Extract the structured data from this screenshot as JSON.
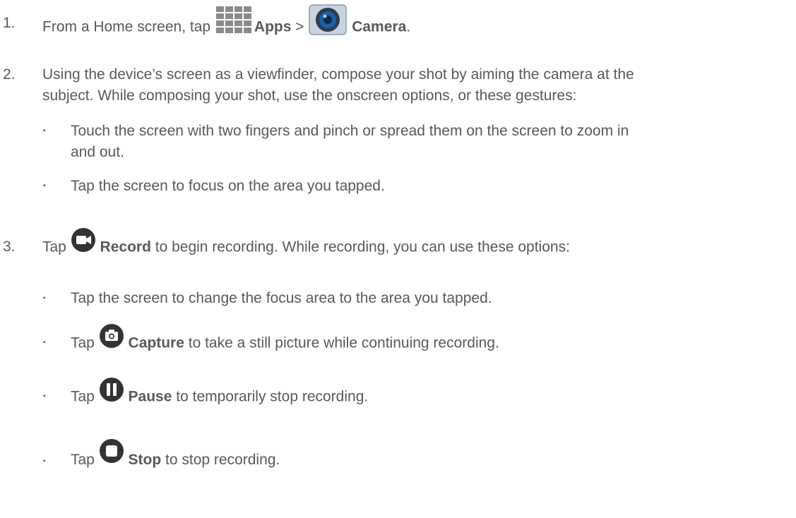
{
  "steps": [
    {
      "number": "1.",
      "pre": "From a Home screen, tap ",
      "apps_label": "Apps",
      "sep": " > ",
      "camera_label": "Camera",
      "post": ".",
      "icons": [
        "apps-grid-icon",
        "camera-app-icon"
      ]
    },
    {
      "number": "2.",
      "line1": "Using the device’s screen as a viewfinder, compose your shot by aiming the camera at the",
      "line2": "subject. While composing your shot, use the onscreen options, or these gestures:",
      "bullets": [
        {
          "line1": "Touch the screen with two fingers and pinch or spread them on the screen to zoom in",
          "line2": "and out."
        },
        {
          "line1": "Tap the screen to focus on the area you tapped."
        }
      ]
    },
    {
      "number": "3.",
      "pre": "Tap ",
      "label": "Record",
      "post": " to begin recording. While recording, you can use these options:",
      "icon": "record-video-icon",
      "bullets": [
        {
          "text": "Tap the screen to change the focus area to the area you tapped."
        },
        {
          "pre": "Tap ",
          "label": "Capture",
          "post": " to take a still picture while continuing recording.",
          "icon": "capture-camera-icon"
        },
        {
          "pre": "Tap ",
          "label": "Pause",
          "post": " to temporarily stop recording.",
          "icon": "pause-icon"
        },
        {
          "pre": "Tap ",
          "label": "Stop",
          "post": " to stop recording.",
          "icon": "stop-icon"
        }
      ]
    }
  ],
  "bullet_glyph": "▪",
  "colors": {
    "text": "#595959",
    "icon_dark": "#333333",
    "icon_camera": "#4a90c8"
  }
}
